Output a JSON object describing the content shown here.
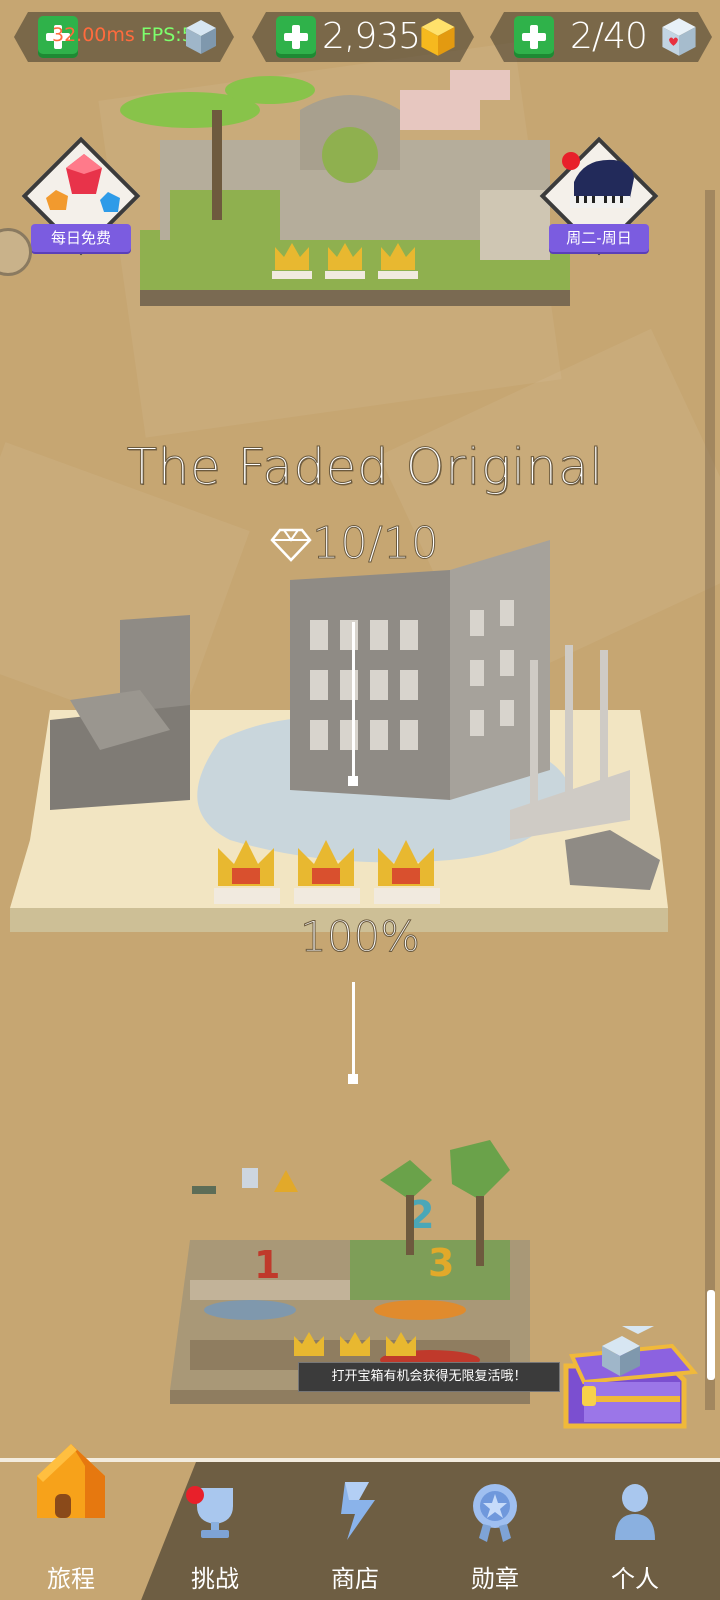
{
  "topbar": {
    "debug_ms": "32.00ms",
    "debug_fps": "FPS:57",
    "currency": "2,935",
    "lives": "2/40"
  },
  "side_badges": {
    "daily_free": "每日免费",
    "schedule": "周二-周日"
  },
  "level": {
    "title": "The Faded Original",
    "gems": "10/10",
    "progress_text": "100%",
    "progress": 1.0
  },
  "tooltip": "打开宝箱有机会获得无限复活哦！",
  "nav": {
    "items": [
      {
        "label": "旅程",
        "icon": "house-icon"
      },
      {
        "label": "挑战",
        "icon": "trophy-icon"
      },
      {
        "label": "商店",
        "icon": "shop-icon"
      },
      {
        "label": "勋章",
        "icon": "medal-icon"
      },
      {
        "label": "个人",
        "icon": "profile-icon"
      }
    ]
  },
  "colors": {
    "background": "#c6a672",
    "nav": "#6e5e43",
    "accent_green": "#2fb24a",
    "badge_purple": "#7b5ce0",
    "notification_red": "#e8202a"
  }
}
